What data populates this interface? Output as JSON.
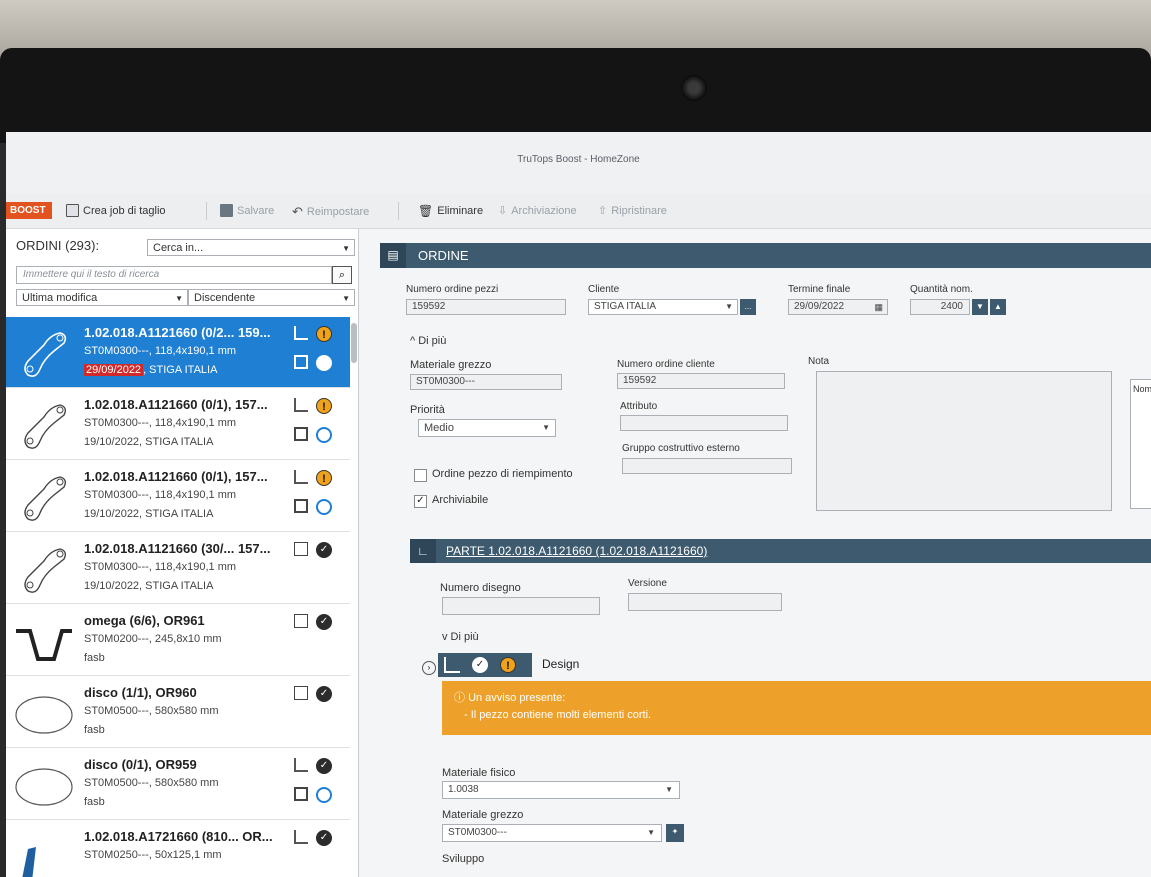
{
  "window": {
    "title": "TruTops Boost - HomeZone"
  },
  "toolbar": {
    "brand": "BOOST",
    "create_job": "Crea job di taglio",
    "save": "Salvare",
    "reset": "Reimpostare",
    "delete": "Eliminare",
    "archive": "Archiviazione",
    "restore": "Ripristinare"
  },
  "orders_panel": {
    "title": "ORDINI (293):",
    "search_scope": "Cerca in...",
    "search_placeholder": "Immettere qui il testo di ricerca",
    "sort_field": "Ultima modifica",
    "sort_order": "Discendente",
    "items": [
      {
        "title": "1.02.018.A1121660 (0/2... 159...",
        "line2": "ST0M0300---, 118,4x190,1 mm",
        "date": "29/09/2022",
        "customer": ", STIGA ITALIA"
      },
      {
        "title": "1.02.018.A1121660 (0/1), 157...",
        "line2": "ST0M0300---, 118,4x190,1 mm",
        "line3": "19/10/2022, STIGA ITALIA"
      },
      {
        "title": "1.02.018.A1121660 (0/1), 157...",
        "line2": "ST0M0300---, 118,4x190,1 mm",
        "line3": "19/10/2022, STIGA ITALIA"
      },
      {
        "title": "1.02.018.A1121660 (30/... 157...",
        "line2": "ST0M0300---, 118,4x190,1 mm",
        "line3": "19/10/2022, STIGA ITALIA"
      },
      {
        "title": "omega (6/6),  OR961",
        "line2": "ST0M0200---, 245,8x10 mm",
        "line3": "fasb"
      },
      {
        "title": "disco (1/1),  OR960",
        "line2": "ST0M0500---, 580x580 mm",
        "line3": "fasb"
      },
      {
        "title": "disco (0/1),  OR959",
        "line2": "ST0M0500---, 580x580 mm",
        "line3": "fasb"
      },
      {
        "title": "1.02.018.A1721660 (810... OR...",
        "line2": "ST0M0250---, 50x125,1 mm"
      }
    ]
  },
  "order": {
    "header": "ORDINE",
    "order_number_label": "Numero ordine pezzi",
    "order_number": "159592",
    "customer_label": "Cliente",
    "customer": "STIGA ITALIA",
    "customer_btn": "...",
    "deadline_label": "Termine finale",
    "deadline": "29/09/2022",
    "qty_label": "Quantità nom.",
    "qty": "2400",
    "more": "^  Di più",
    "raw_material_label": "Materiale grezzo",
    "raw_material": "ST0M0300---",
    "client_order_label": "Numero ordine cliente",
    "client_order": "159592",
    "note_label": "Nota",
    "priority_label": "Priorità",
    "priority": "Medio",
    "attribute_label": "Attributo",
    "external_group_label": "Gruppo costruttivo esterno",
    "fill_order_label": "Ordine pezzo di riempimento",
    "archivable_label": "Archiviabile",
    "side_header": "Nom"
  },
  "part": {
    "header": "PARTE 1.02.018.A1121660 (1.02.018.A1121660)",
    "drawing_label": "Numero disegno",
    "version_label": "Versione",
    "more": "v  Di più",
    "design_tab": "Design",
    "alert_title": "Un avviso presente:",
    "alert_text": "-   Il pezzo contiene molti elementi corti.",
    "phys_material_label": "Materiale fisico",
    "phys_material": "1.0038",
    "raw_material_label": "Materiale grezzo",
    "raw_material": "ST0M0300---",
    "development_label": "Sviluppo"
  }
}
